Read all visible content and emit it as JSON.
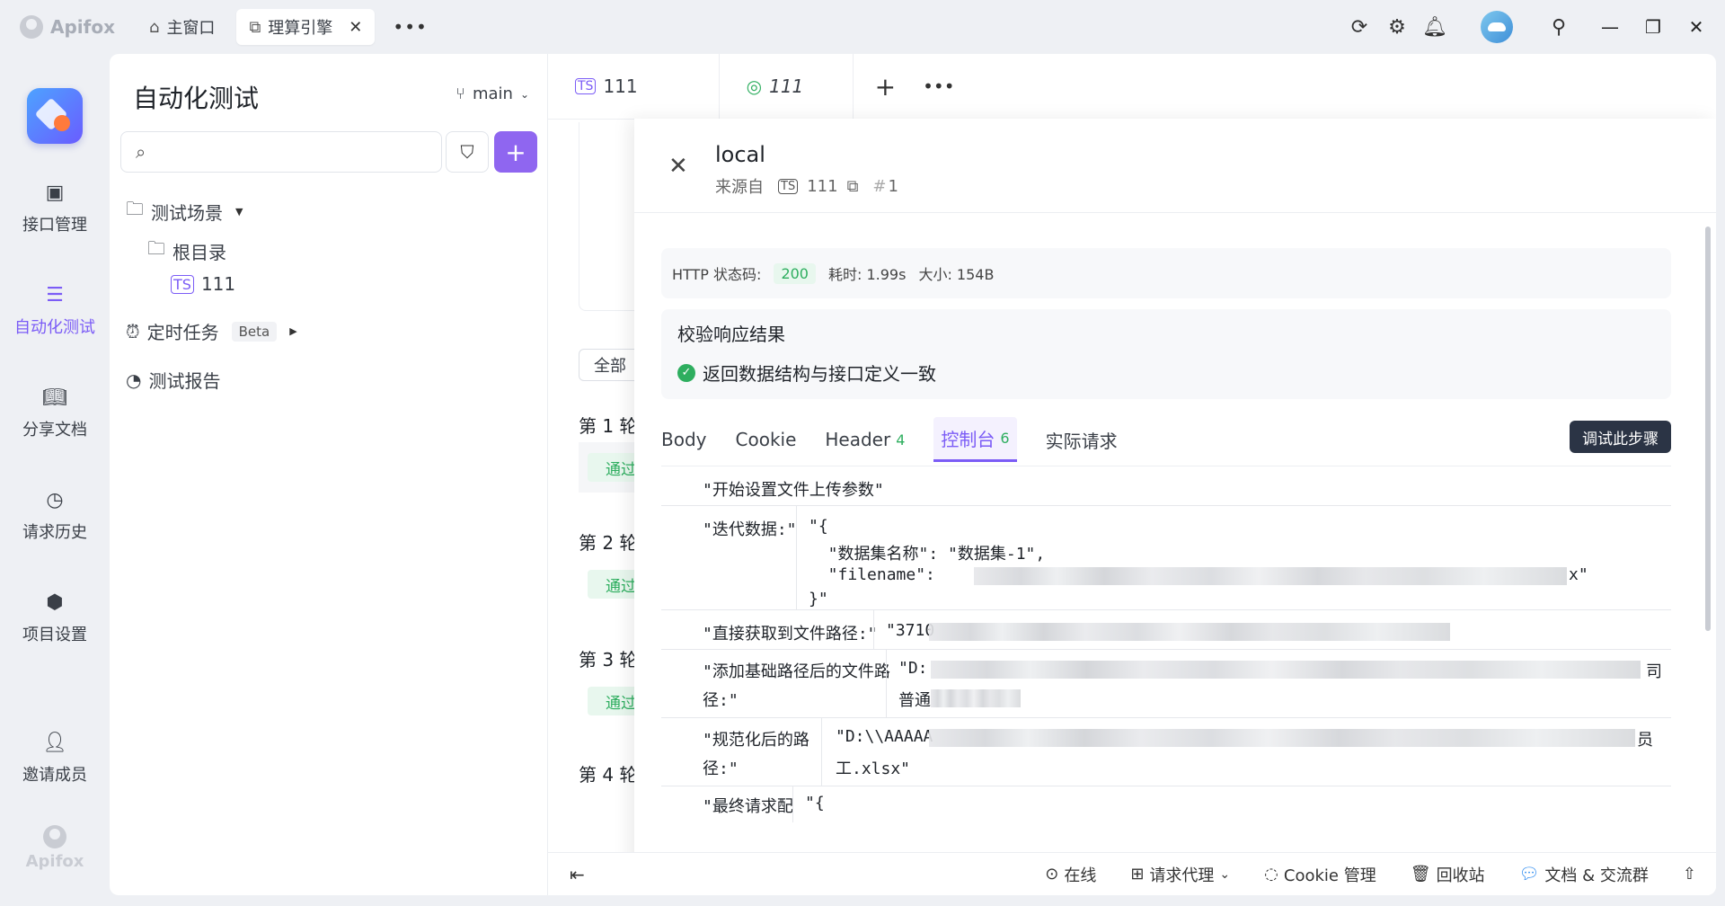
{
  "app": {
    "logo_text": "Apifox"
  },
  "top_tabs": [
    {
      "label": "主窗口"
    },
    {
      "label": "理算引擎"
    }
  ],
  "rail": {
    "items": [
      {
        "label": "接口管理"
      },
      {
        "label": "自动化测试"
      },
      {
        "label": "分享文档"
      },
      {
        "label": "请求历史"
      },
      {
        "label": "项目设置"
      },
      {
        "label": "邀请成员"
      }
    ],
    "bottom_logo": "Apifox"
  },
  "sidebar": {
    "title": "自动化测试",
    "branch": "main",
    "search_placeholder": "",
    "tree": {
      "scenes": "测试场景",
      "root": "根目录",
      "item": "111",
      "scheduled": "定时任务",
      "beta": "Beta",
      "reports": "测试报告"
    }
  },
  "main": {
    "tabs": [
      {
        "label": "111"
      },
      {
        "label": "111"
      }
    ],
    "all_chip": "全部",
    "rounds": [
      "第 1 轮",
      "第 2 轮",
      "第 3 轮",
      "第 4 轮"
    ],
    "pass_label": "通过"
  },
  "drawer": {
    "title": "local",
    "source_label": "来源自",
    "source_name": "111",
    "source_num": "1",
    "status_label": "HTTP 状态码:",
    "status_code": "200",
    "time_label": "耗时: 1.99s",
    "size_label": "大小: 154B",
    "verify_title": "校验响应结果",
    "verify_item": "返回数据结构与接口定义一致",
    "tabs": [
      {
        "label": "Body"
      },
      {
        "label": "Cookie"
      },
      {
        "label": "Header",
        "count": "4"
      },
      {
        "label": "控制台",
        "count": "6"
      },
      {
        "label": "实际请求"
      }
    ],
    "debug_button": "调试此步骤",
    "console": {
      "row1": "\"开始设置文件上传参数\"",
      "row2_key": "\"迭代数据:\"",
      "row2_v1": "\"{",
      "row2_v2": "  \"数据集名称\": \"数据集-1\",",
      "row2_v3": "  \"filename\":",
      "row2_v3_end": "x\"",
      "row2_v4": "}\"",
      "row3_key": "\"直接获取到文件路径:\"",
      "row3_val": "\"3710",
      "row4_key_l1": "\"添加基础路径后的文件路",
      "row4_key_l2": "径:\"",
      "row4_val_l1": "\"D:",
      "row4_val_l1_end": "司",
      "row4_val_l2": "普通",
      "row5_key_l1": "\"规范化后的路",
      "row5_key_l2": "径:\"",
      "row5_val_l1": "\"D:\\\\AAAAA",
      "row5_val_l1_end": "员",
      "row5_val_l2": "工.xlsx\"",
      "row6_key": "\"最终请求配",
      "row6_val": "\"{"
    }
  },
  "bottombar": {
    "online": "在线",
    "proxy": "请求代理",
    "cookie": "Cookie 管理",
    "recycle": "回收站",
    "docs": "文档 & 交流群"
  }
}
